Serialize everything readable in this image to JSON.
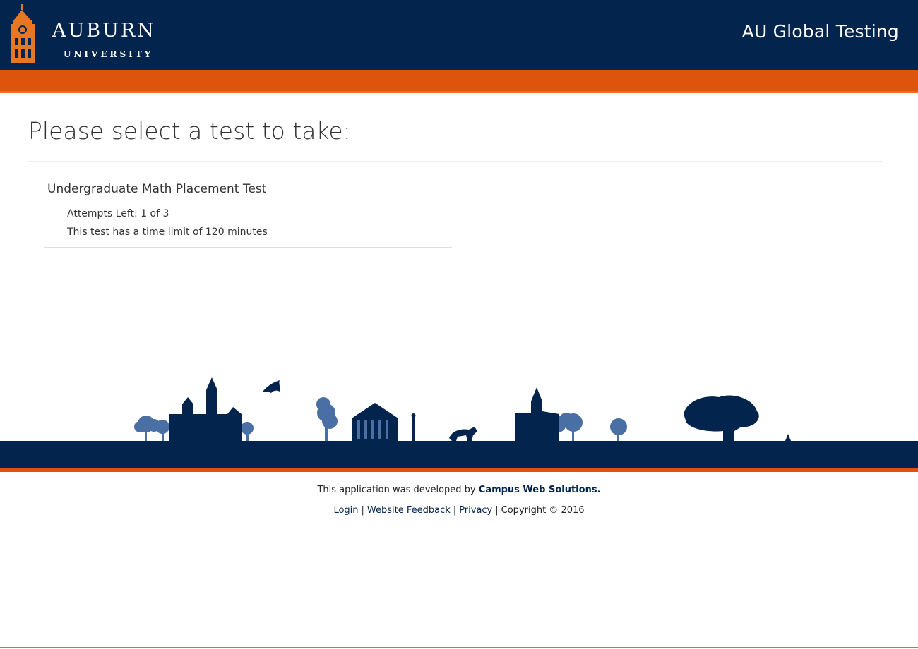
{
  "header": {
    "logo_word": "AUBURN",
    "logo_sub": "UNIVERSITY",
    "app_title": "AU Global Testing"
  },
  "main": {
    "heading": "Please select a test to take:",
    "tests": [
      {
        "title": "Undergraduate Math Placement Test",
        "attempts": "Attempts Left: 1 of 3",
        "time_limit": "This test has a time limit of 120 minutes"
      }
    ]
  },
  "footer": {
    "dev_prefix": "This application was developed by",
    "dev_name": "Campus Web Solutions",
    "dev_suffix": ".",
    "links": [
      "Login",
      "Website Feedback",
      "Privacy",
      "Copyright © 2016"
    ],
    "separator": "|"
  },
  "colors": {
    "navy": "#03244d",
    "orange": "#dd550c",
    "skyline_light": "#4a6fa5"
  }
}
